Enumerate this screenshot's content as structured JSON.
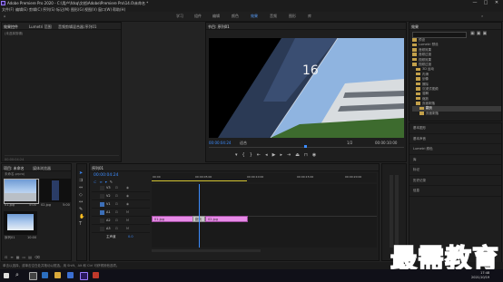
{
  "window": {
    "title": "Adobe Premiere Pro 2020 - C:\\用户\\fdsq\\文档\\Adobe\\Premiere Pro\\14.0\\未命名 *",
    "controls": [
      "—",
      "□",
      "✕"
    ]
  },
  "menu": [
    "文件(F)",
    "编辑(E)",
    "剪辑(C)",
    "序列(S)",
    "标记(M)",
    "图形(G)",
    "视图(V)",
    "窗口(W)",
    "帮助(H)"
  ],
  "workspaces": {
    "items": [
      "学习",
      "组件",
      "编辑",
      "颜色",
      "效果",
      "音频",
      "图形",
      "库"
    ],
    "active": "效果"
  },
  "source_panel": {
    "tabs": [
      "效果控件",
      "Lumetri 范围",
      "音频剪辑混合器:序列01"
    ],
    "selected_text": "(未选择剪辑)"
  },
  "program_monitor": {
    "tab": "节目: 序列01",
    "timecode_left": "00:00:04:24",
    "fit": "适合",
    "quality": "1/2",
    "timecode_right": "00:00:10:00",
    "preview_overlay_text": "16"
  },
  "effects_panel": {
    "title": "效果",
    "tree": [
      {
        "label": "预设",
        "indent": 0
      },
      {
        "label": "Lumetri 预设",
        "indent": 0
      },
      {
        "label": "音频效果",
        "indent": 0
      },
      {
        "label": "音频过渡",
        "indent": 0
      },
      {
        "label": "视频效果",
        "indent": 0
      },
      {
        "label": "视频过渡",
        "indent": 0
      },
      {
        "label": "3D 运动",
        "indent": 1
      },
      {
        "label": "内滑",
        "indent": 1
      },
      {
        "label": "划像",
        "indent": 1
      },
      {
        "label": "擦除",
        "indent": 1
      },
      {
        "label": "沉浸式视频",
        "indent": 1
      },
      {
        "label": "溶解",
        "indent": 1
      },
      {
        "label": "缩放",
        "indent": 1
      },
      {
        "label": "页面剥落",
        "indent": 1
      },
      {
        "label": "翻页",
        "indent": 2
      },
      {
        "label": "页面剥落",
        "indent": 2
      }
    ],
    "selected": "翻页",
    "lower_sections": [
      "基本图形",
      "基本声音",
      "Lumetri 颜色",
      "库",
      "标记",
      "历史记录",
      "信息"
    ]
  },
  "project_panel": {
    "tabs": [
      "项目: 未命名",
      "媒体浏览器"
    ],
    "path": "未命名.prproj",
    "items": [
      {
        "name": "01.jpg",
        "duration": "5:00"
      },
      {
        "name": "02.jpg",
        "duration": "5:00"
      },
      {
        "name": "序列01",
        "duration": "10:00"
      }
    ]
  },
  "timeline": {
    "tab": "序列01",
    "timecode": "00:00:04:24",
    "ruler": [
      "00:00",
      "00:00:05:00",
      "00:00:10:00",
      "00:00:15:00",
      "00:00:20:00"
    ],
    "tracks": {
      "video": [
        "V3",
        "V2",
        "V1"
      ],
      "audio": [
        "A1",
        "A2",
        "A3"
      ],
      "master": "主声道",
      "master_value": "0.0"
    },
    "clips": [
      {
        "label": "01.jpg",
        "track": "V1"
      },
      {
        "label": "翻页",
        "track": "V1"
      },
      {
        "label": "02.jpg",
        "track": "V1"
      }
    ]
  },
  "status_bar": {
    "text": "单击以选择，或单击空白处并拖动以框选。用 Shift、Alt 和 Ctrl 可获得其他选项。"
  },
  "taskbar": {
    "time": "17:48",
    "date": "2021/10/19"
  },
  "watermark": {
    "text": "最需教育"
  },
  "colors": {
    "accent": "#3c8cff",
    "clip": "#e78ae7",
    "timeline_work_bar": "#d6c633",
    "watermark": "#3a6bd1"
  }
}
